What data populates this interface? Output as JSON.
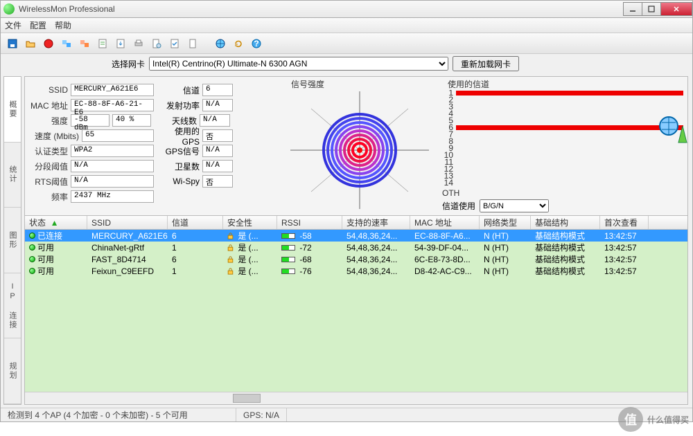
{
  "app": {
    "title": "WirelessMon Professional"
  },
  "menu": {
    "file": "文件",
    "config": "配置",
    "help": "帮助"
  },
  "toolbar_icons": [
    "save",
    "open",
    "record",
    "copy-options",
    "copy-clipboard",
    "log-csv",
    "export",
    "print",
    "page-setup",
    "options",
    "page",
    "globe",
    "refresh",
    "help"
  ],
  "adapter": {
    "label": "选择网卡",
    "selected": "Intel(R) Centrino(R) Ultimate-N 6300 AGN",
    "reload_btn": "重新加载网卡"
  },
  "sidetabs": {
    "summary": "概要",
    "stats": "统计",
    "graph": "图形",
    "ipconn": "IP 连接",
    "plan": "规划"
  },
  "details": {
    "labels": {
      "ssid": "SSID",
      "mac": "MAC 地址",
      "strength": "强度",
      "speed": "速度 (Mbits)",
      "auth": "认证类型",
      "frag": "分段阈值",
      "rts": "RTS阈值",
      "freq": "频率",
      "channel": "信道",
      "txpower": "发射功率",
      "antennas": "天线数",
      "gps_used": "使用的GPS",
      "gps_signal": "GPS信号",
      "satellites": "卫星数",
      "wispy": "Wi-Spy"
    },
    "ssid": "MERCURY_A621E6",
    "mac": "EC-88-8F-A6-21-E6",
    "strength_dbm": "-58 dBm",
    "strength_pct": "40 %",
    "speed": "65",
    "auth": "WPA2",
    "frag": "N/A",
    "rts": "N/A",
    "freq": "2437 MHz",
    "channel": "6",
    "txpower": "N/A",
    "antennas": "N/A",
    "gps_used": "否",
    "gps_signal": "N/A",
    "satellites": "N/A",
    "wispy": "否"
  },
  "boxes": {
    "signal_title": "信号强度",
    "channels_title": "使用的信道",
    "oth_label": "OTH",
    "channel_use_label": "信道使用",
    "channel_use_sel": "B/G/N"
  },
  "channels_used": [
    1,
    6
  ],
  "channel_rows": [
    1,
    2,
    3,
    4,
    5,
    6,
    7,
    8,
    9,
    10,
    11,
    12,
    13,
    14
  ],
  "columns": [
    "状态",
    "SSID",
    "信道",
    "安全性",
    "RSSI",
    "支持的速率",
    "MAC 地址",
    "网络类型",
    "基础结构",
    "首次查看"
  ],
  "sort_indicator": "▲",
  "networks": [
    {
      "status": "已连接",
      "ssid": "MERCURY_A621E6",
      "channel": "6",
      "secure": "是 (...",
      "rssi": "-58",
      "rates": "54,48,36,24...",
      "mac": "EC-88-8F-A6...",
      "nettype": "N (HT)",
      "infra": "基础结构模式",
      "first": "13:42:57",
      "selected": true
    },
    {
      "status": "可用",
      "ssid": "ChinaNet-gRtf",
      "channel": "1",
      "secure": "是 (...",
      "rssi": "-72",
      "rates": "54,48,36,24...",
      "mac": "54-39-DF-04...",
      "nettype": "N (HT)",
      "infra": "基础结构模式",
      "first": "13:42:57"
    },
    {
      "status": "可用",
      "ssid": "FAST_8D4714",
      "channel": "6",
      "secure": "是 (...",
      "rssi": "-68",
      "rates": "54,48,36,24...",
      "mac": "6C-E8-73-8D...",
      "nettype": "N (HT)",
      "infra": "基础结构模式",
      "first": "13:42:57"
    },
    {
      "status": "可用",
      "ssid": "Feixun_C9EEFD",
      "channel": "1",
      "secure": "是 (...",
      "rssi": "-76",
      "rates": "54,48,36,24...",
      "mac": "D8-42-AC-C9...",
      "nettype": "N (HT)",
      "infra": "基础结构模式",
      "first": "13:42:57"
    }
  ],
  "status": {
    "ap": "检测到 4 个AP (4 个加密 - 0 个未加密) - 5 个可用",
    "gps": "GPS: N/A"
  },
  "watermark": "什么值得买"
}
